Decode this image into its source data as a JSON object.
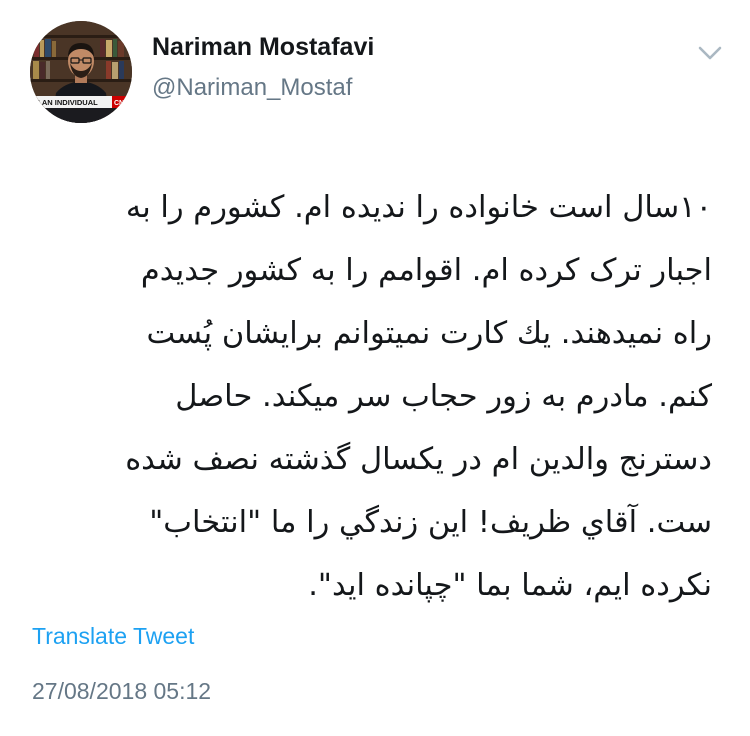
{
  "author": {
    "display_name": "Nariman Mostafavi",
    "handle": "@Nariman_Mostaf",
    "avatar_caption": "IS AN INDIVIDUAL",
    "avatar_logo": "CNN"
  },
  "icons": {
    "menu": "chevron-down-icon"
  },
  "tweet": {
    "lines": [
      "۱۰سال است خانواده را نديده ام. کشورم را به",
      "اجبار ترک کرده ام. اقوامم را به کشور جديدم",
      "راه نميدهند. يك كارت نميتوانم برايشان پُست",
      "کنم. مادرم به زور حجاب سر ميکند. حاصل",
      "دسترنج والدين ام در يکسال گذشته نصف شده",
      "ست. آقاي ظريف! اين زندگي را ما \"انتخاب\"",
      "نکرده ايم، شما بما \"چپانده ايد\"."
    ]
  },
  "footer": {
    "translate_label": "Translate Tweet",
    "timestamp": "27/08/2018 05:12"
  },
  "colors": {
    "link": "#1da1f2",
    "secondary_text": "#657786",
    "primary_text": "#14171a",
    "chevron": "#aab8c2"
  }
}
